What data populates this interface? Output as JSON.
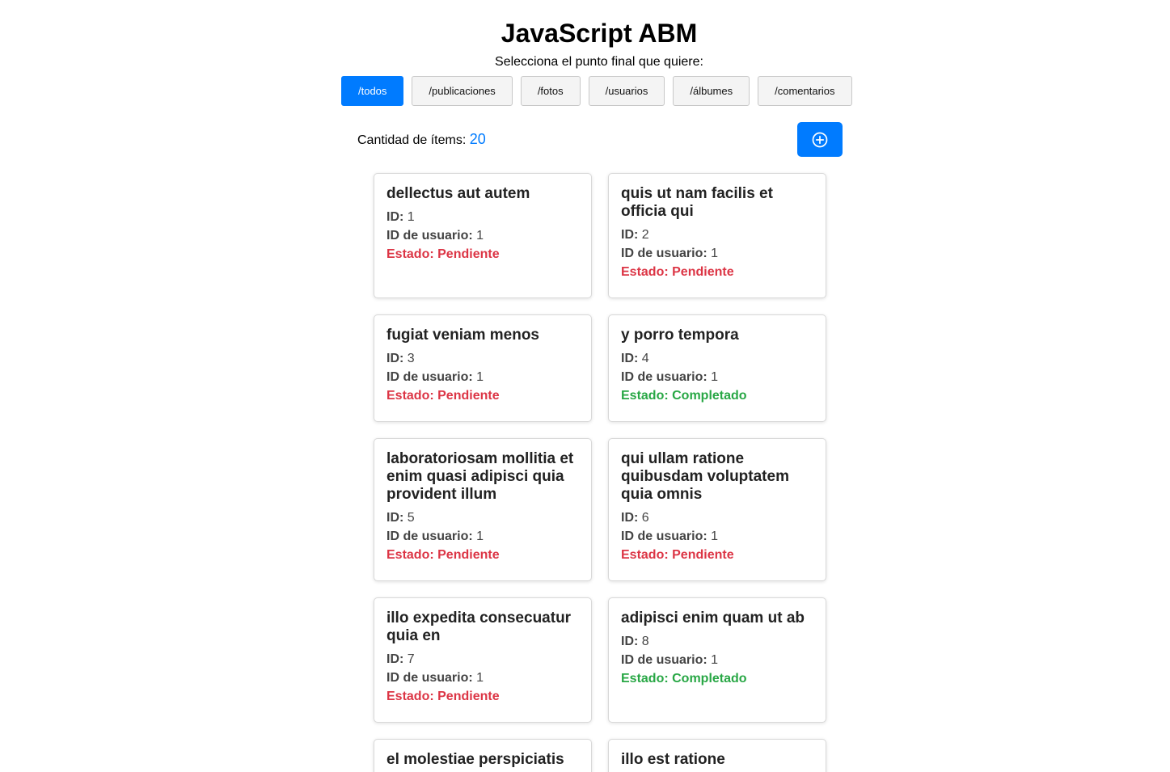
{
  "header": {
    "title": "JavaScript ABM",
    "subtitle": "Selecciona el punto final que quiere:"
  },
  "endpoints": [
    {
      "label": "/todos",
      "active": true
    },
    {
      "label": "/publicaciones",
      "active": false
    },
    {
      "label": "/fotos",
      "active": false
    },
    {
      "label": "/usuarios",
      "active": false
    },
    {
      "label": "/álbumes",
      "active": false
    },
    {
      "label": "/comentarios",
      "active": false
    }
  ],
  "summary": {
    "count_label": "Cantidad de ítems:",
    "count_value": "20",
    "add_icon": "plus-circle-icon"
  },
  "labels": {
    "id": "ID:",
    "user_id": "ID de usuario:",
    "status_prefix": "Estado:"
  },
  "colors": {
    "accent": "#007bff",
    "pending": "#dc3545",
    "completed": "#28a745"
  },
  "items": [
    {
      "title": "dellectus aut autem",
      "id": "1",
      "user_id": "1",
      "status": "Pendiente",
      "completed": false
    },
    {
      "title": "quis ut nam facilis et officia qui",
      "id": "2",
      "user_id": "1",
      "status": "Pendiente",
      "completed": false
    },
    {
      "title": "fugiat veniam menos",
      "id": "3",
      "user_id": "1",
      "status": "Pendiente",
      "completed": false
    },
    {
      "title": "y porro tempora",
      "id": "4",
      "user_id": "1",
      "status": "Completado",
      "completed": true
    },
    {
      "title": "laboratoriosam mollitia et enim quasi adipisci quia provident illum",
      "id": "5",
      "user_id": "1",
      "status": "Pendiente",
      "completed": false
    },
    {
      "title": "qui ullam ratione quibusdam voluptatem quia omnis",
      "id": "6",
      "user_id": "1",
      "status": "Pendiente",
      "completed": false
    },
    {
      "title": "illo expedita consecuatur quia en",
      "id": "7",
      "user_id": "1",
      "status": "Pendiente",
      "completed": false
    },
    {
      "title": "adipisci enim quam ut ab",
      "id": "8",
      "user_id": "1",
      "status": "Completado",
      "completed": true
    },
    {
      "title": "el molestiae perspiciatis",
      "id": "",
      "user_id": "",
      "status": "",
      "completed": false
    },
    {
      "title": "illo est ratione",
      "id": "",
      "user_id": "",
      "status": "",
      "completed": false
    }
  ]
}
